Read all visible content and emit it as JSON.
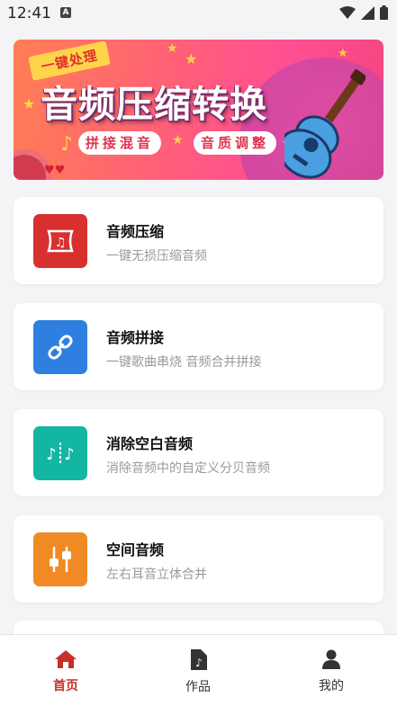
{
  "status": {
    "time": "12:41"
  },
  "banner": {
    "ribbon": "一键处理",
    "title": "音频压缩转换",
    "pill1": "拼接混音",
    "pill2": "音质调整"
  },
  "cards": [
    {
      "title": "音频压缩",
      "desc": "一键无损压缩音频",
      "color": "#d8302f"
    },
    {
      "title": "音频拼接",
      "desc": "一键歌曲串烧 音频合并拼接",
      "color": "#2e7fe0"
    },
    {
      "title": "消除空白音频",
      "desc": "消除音频中的自定义分贝音频",
      "color": "#12b6a2"
    },
    {
      "title": "空间音频",
      "desc": "左右耳音立体合并",
      "color": "#f08a24"
    }
  ],
  "nav": {
    "home": "首页",
    "works": "作品",
    "mine": "我的",
    "active_color": "#c6302b",
    "inactive_color": "#333333"
  }
}
